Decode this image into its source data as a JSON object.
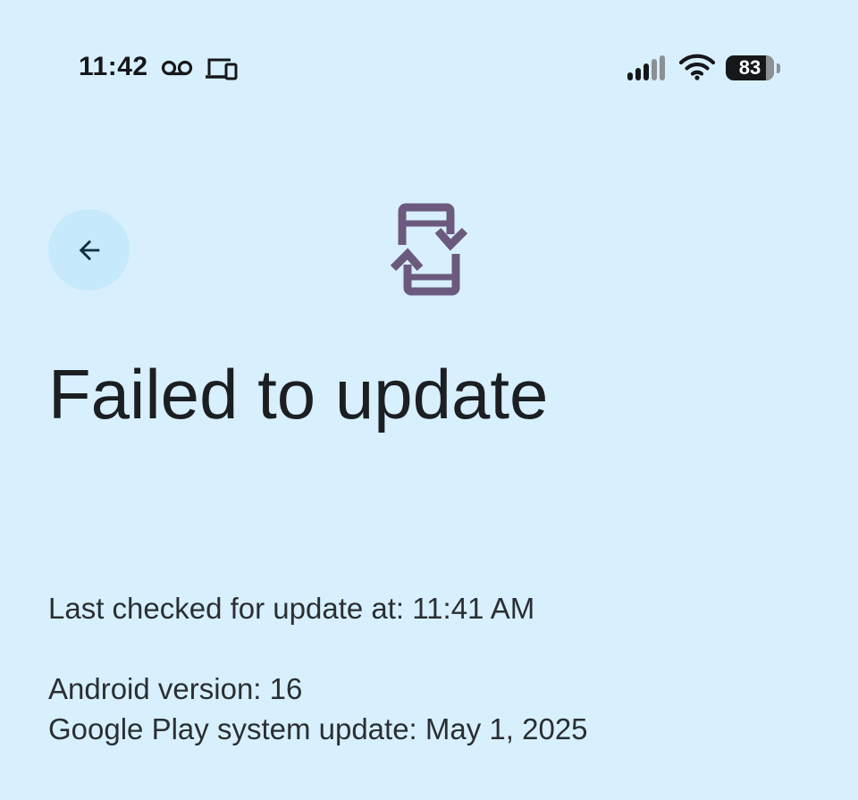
{
  "status_bar": {
    "time": "11:42",
    "battery_level": "83",
    "icons": [
      "voicemail-icon",
      "cast-icon",
      "signal-icon",
      "wifi-icon",
      "battery-icon"
    ]
  },
  "header": {
    "back_icon": "arrow-back-icon",
    "status_icon": "system-update-icon"
  },
  "main": {
    "title": "Failed to update",
    "last_checked_label": "Last checked for update at:",
    "last_checked_time": "11:41 AM",
    "android_version_label": "Android version:",
    "android_version": "16",
    "play_update_label": "Google Play system update:",
    "play_update_date": "May 1, 2025"
  },
  "colors": {
    "background": "#d8f0fe",
    "back_button_bg": "#c6e9fb",
    "update_icon": "#6b5a7e",
    "text": "#1b1f22"
  }
}
